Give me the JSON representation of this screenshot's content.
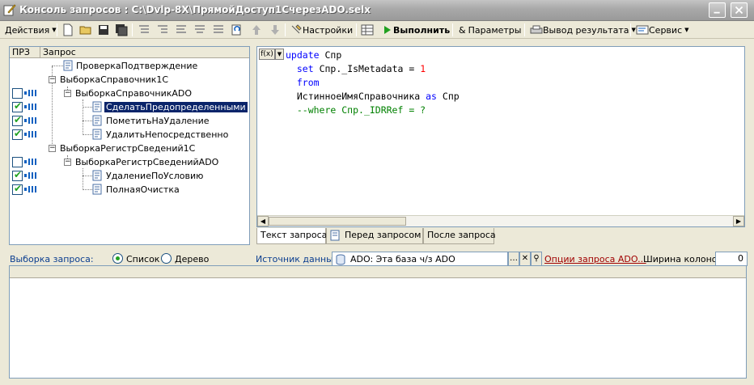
{
  "window": {
    "title": "Консоль запросов : C:\\Dvlp-8X\\ПрямойДоступ1СчерезADO.selx",
    "icon": "window-pencil-icon"
  },
  "toolbar": {
    "actions_label": "Действия",
    "settings_label": "Настройки",
    "run_label": "Выполнить",
    "params_label": "Параметры",
    "output_label": "Вывод результата",
    "service_label": "Сервис"
  },
  "tree": {
    "columns": [
      "ПРЗ",
      "Запрос"
    ],
    "nodes": [
      {
        "label": "ПроверкаПодтверждение",
        "checkbox": false,
        "checked": false
      },
      {
        "label": "ВыборкаСправочник1С",
        "checkbox": false,
        "checked": false
      },
      {
        "label": "ВыборкаСправочникADO",
        "checkbox": true,
        "checked": false
      },
      {
        "label": "СделатьПредопределенными",
        "checkbox": true,
        "checked": true,
        "selected": true
      },
      {
        "label": "ПометитьНаУдаление",
        "checkbox": true,
        "checked": true
      },
      {
        "label": "УдалитьНепосредственно",
        "checkbox": true,
        "checked": true
      },
      {
        "label": "ВыборкаРегистрСведений1С",
        "checkbox": false,
        "checked": false
      },
      {
        "label": "ВыборкаРегистрСведенийADO",
        "checkbox": true,
        "checked": false
      },
      {
        "label": "УдалениеПоУсловию",
        "checkbox": true,
        "checked": true
      },
      {
        "label": "ПолнаяОчистка",
        "checkbox": true,
        "checked": true
      }
    ]
  },
  "editor": {
    "fx_label": "f(x)",
    "lines": [
      [
        "update",
        "Спр"
      ],
      [
        "set",
        "Спр._IsMetadata",
        "=",
        "1"
      ],
      [
        "from"
      ],
      [
        "ИстинноеИмяСправочника",
        "as",
        "Спр"
      ],
      [
        "--where Спр._IDRRef = ?"
      ]
    ]
  },
  "tabs": {
    "query_text": "Текст запроса",
    "before": "Перед запросом",
    "after": "После запроса"
  },
  "selection": {
    "label": "Выборка запроса:",
    "opt_list": "Список",
    "opt_tree": "Дерево",
    "source_label": "Источник данных:",
    "source_value": "ADO: Эта база ч/з ADO",
    "options_link": "Опции запроса ADO...",
    "col_width_label": "Ширина колонок:",
    "col_width_value": "0"
  },
  "colors": {
    "keyword": "#0000ff",
    "number": "#ff0000",
    "comment": "#008000",
    "selection": "#0a246a",
    "check": "#21a121"
  }
}
